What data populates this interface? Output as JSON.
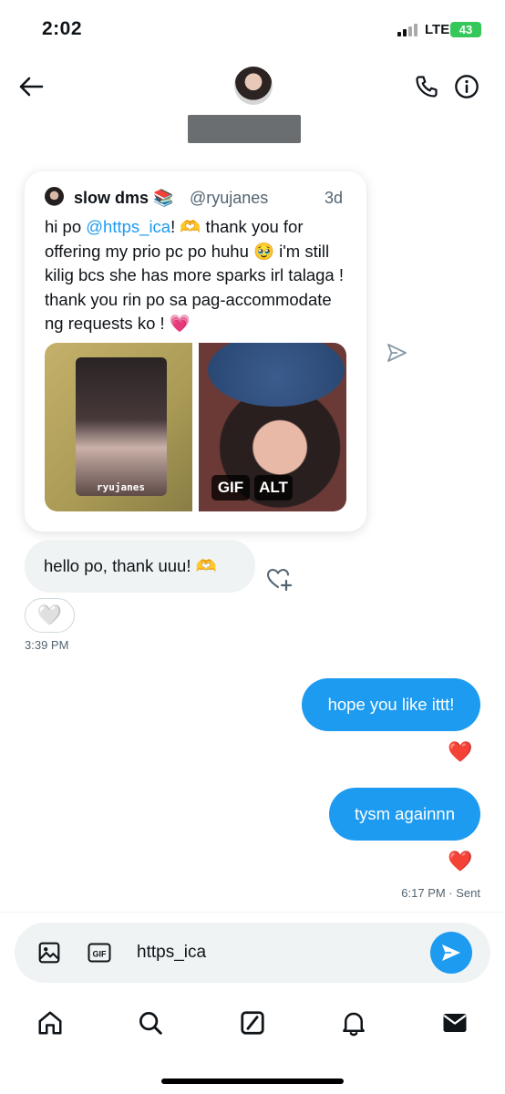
{
  "status_bar": {
    "time": "2:02",
    "network": "LTE",
    "battery": "43"
  },
  "header": {
    "back_icon": "arrow-left-icon",
    "call_icon": "phone-icon",
    "info_icon": "info-circle-icon"
  },
  "quoted_post": {
    "display_name": "slow dms 📚",
    "handle": "@ryujanes",
    "time": "3d",
    "text_before_mention": "hi po ",
    "mention": "@https_ica",
    "text_after_mention": "! 🫶 thank you for offering my prio pc po huhu 🥹 i'm still kilig bcs she has more sparks irl talaga ! thank you rin po sa pag-accommodate ng requests ko ! 💗",
    "media_left_label": "ryujanes",
    "media_badges": [
      "GIF",
      "ALT"
    ]
  },
  "messages": {
    "received": {
      "text": "hello po, thank uuu! 🫶",
      "reaction": "🤍",
      "time": "3:39 PM"
    },
    "sent": [
      {
        "text": "hope you like ittt!",
        "reaction": "❤️"
      },
      {
        "text": "tysm againnn",
        "reaction": "❤️"
      }
    ],
    "sent_time": "6:17 PM · Sent"
  },
  "composer": {
    "value": "https_ica"
  },
  "colors": {
    "accent": "#1d9bf0",
    "bubble_received": "#eff3f4",
    "muted": "#536471",
    "heart": "#e0245e"
  },
  "tab_bar": [
    "home-icon",
    "search-icon",
    "grok-icon",
    "bell-icon",
    "mail-icon"
  ]
}
